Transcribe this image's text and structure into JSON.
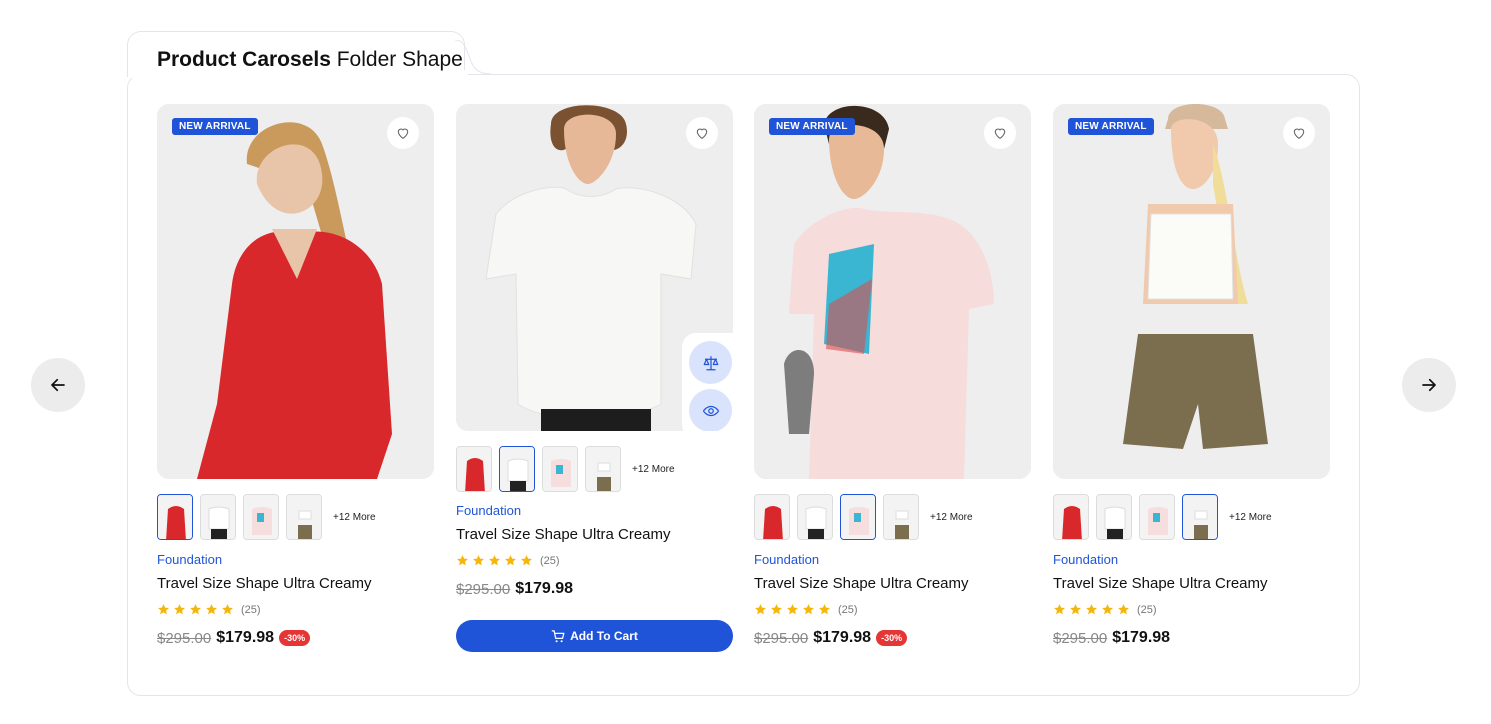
{
  "section": {
    "title_bold": "Product Carosels",
    "title_light": "Folder Shape"
  },
  "nav": {
    "prev_icon": "arrow-left-icon",
    "next_icon": "arrow-right-icon"
  },
  "colors": {
    "accent": "#1f54d9",
    "discount": "#e63535",
    "star": "#f5b70a"
  },
  "products": [
    {
      "badge": "NEW ARRIVAL",
      "more": "+12 More",
      "category": "Foundation",
      "name": "Travel Size Shape Ultra Creamy",
      "rating_count": "(25)",
      "old_price": "$295.00",
      "new_price": "$179.98",
      "discount": "-30%",
      "active_swatch": 0
    },
    {
      "badge": "",
      "more": "+12 More",
      "category": "Foundation",
      "name": "Travel Size Shape Ultra Creamy",
      "rating_count": "(25)",
      "old_price": "$295.00",
      "new_price": "$179.98",
      "discount": "",
      "cart_label": "Add To Cart",
      "active_swatch": 1
    },
    {
      "badge": "NEW ARRIVAL",
      "more": "+12 More",
      "category": "Foundation",
      "name": "Travel Size Shape Ultra Creamy",
      "rating_count": "(25)",
      "old_price": "$295.00",
      "new_price": "$179.98",
      "discount": "-30%",
      "active_swatch": 2
    },
    {
      "badge": "NEW ARRIVAL",
      "more": "+12 More",
      "category": "Foundation",
      "name": "Travel Size Shape Ultra Creamy",
      "rating_count": "(25)",
      "old_price": "$295.00",
      "new_price": "$179.98",
      "discount": "",
      "active_swatch": 3
    }
  ]
}
